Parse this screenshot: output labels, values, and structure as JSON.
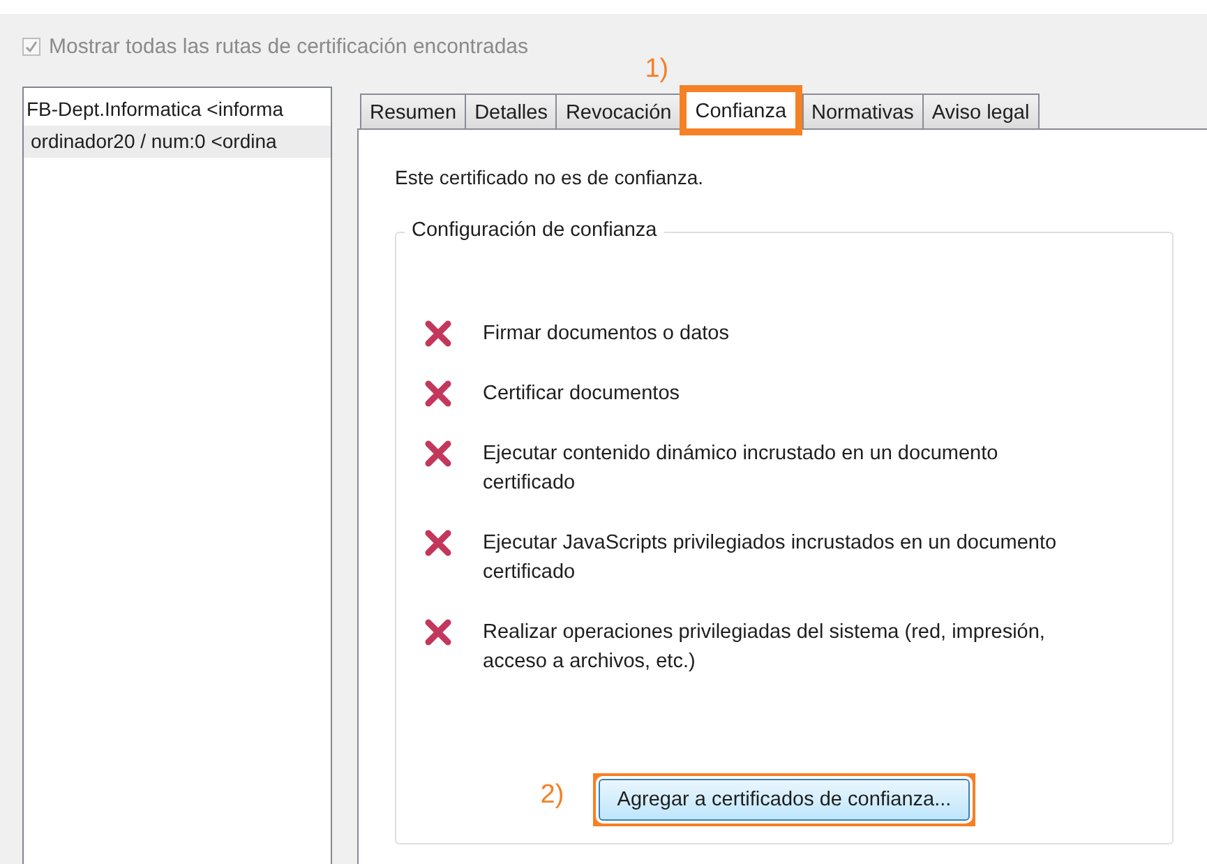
{
  "show_all_paths": {
    "label": "Mostrar todas las rutas de certificación encontradas",
    "checked": true,
    "disabled": true
  },
  "path_list": [
    {
      "label": "FB-Dept.Informatica <informa",
      "selected": false
    },
    {
      "label": "ordinador20 / num:0 <ordina",
      "selected": true
    }
  ],
  "tabs": [
    {
      "label": "Resumen",
      "selected": false,
      "highlighted": false
    },
    {
      "label": "Detalles",
      "selected": false,
      "highlighted": false
    },
    {
      "label": "Revocación",
      "selected": false,
      "highlighted": false
    },
    {
      "label": "Confianza",
      "selected": true,
      "highlighted": true,
      "annotation": "1)"
    },
    {
      "label": "Normativas",
      "selected": false,
      "highlighted": false
    },
    {
      "label": "Aviso legal",
      "selected": false,
      "highlighted": false
    }
  ],
  "status_text": "Este certificado no es de confianza.",
  "trust_settings": {
    "title": "Configuración de confianza",
    "items": [
      {
        "label": "Firmar documentos o datos",
        "allowed": false
      },
      {
        "label": "Certificar documentos",
        "allowed": false
      },
      {
        "label": "Ejecutar contenido dinámico incrustado en un documento certificado",
        "allowed": false
      },
      {
        "label": "Ejecutar JavaScripts privilegiados incrustados en un documento certificado",
        "allowed": false
      },
      {
        "label": "Realizar operaciones privilegiadas del sistema (red, impresión, acceso a archivos, etc.)",
        "allowed": false
      }
    ],
    "button": {
      "label": "Agregar a certificados de confianza...",
      "highlighted": true,
      "annotation": "2)"
    }
  }
}
